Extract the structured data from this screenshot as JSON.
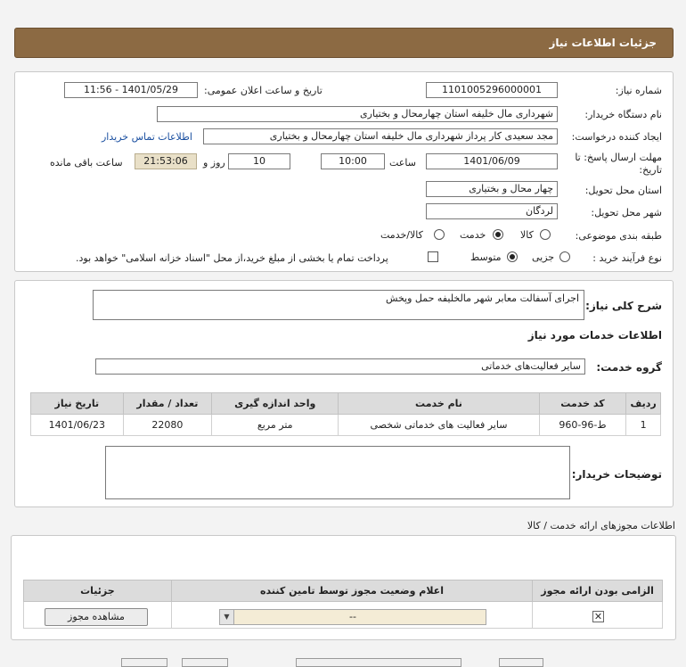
{
  "page_title": "جزئیات اطلاعات نیاز",
  "need_number": {
    "label": "شماره نیاز:",
    "value": "1101005296000001"
  },
  "announce_datetime": {
    "label": "تاریخ و ساعت اعلان عمومی:",
    "value": "1401/05/29 - 11:56"
  },
  "buyer_org": {
    "label": "نام دستگاه خریدار:",
    "value": "شهرداری مال خلیفه استان چهارمحال و بختیاری"
  },
  "requester": {
    "label": "ایجاد کننده درخواست:",
    "value": "مجد سعیدی کار پرداز شهرداری مال خلیفه استان چهارمحال و بختیاری",
    "contact_link": "اطلاعات تماس خریدار"
  },
  "deadline": {
    "label_line1": "مهلت ارسال پاسخ: تا",
    "label_line2": "تاریخ:",
    "date": "1401/06/09",
    "time_label": "ساعت",
    "time": "10:00",
    "days": "10",
    "days_label": "روز و",
    "remaining": "21:53:06",
    "remaining_label": "ساعت باقی مانده"
  },
  "delivery_province": {
    "label": "استان محل تحویل:",
    "value": "چهار محال و بختیاری"
  },
  "delivery_city": {
    "label": "شهر محل تحویل:",
    "value": "لردگان"
  },
  "category": {
    "label": "طبقه بندی موضوعی:",
    "options": [
      "کالا",
      "خدمت",
      "کالا/خدمت"
    ],
    "selected": "خدمت"
  },
  "purchase_process": {
    "label": "نوع فرآیند خرید :",
    "options": [
      "جزیی",
      "متوسط"
    ],
    "selected": "متوسط",
    "treasury_note": "پرداخت تمام یا بخشی از مبلغ خرید،از محل \"اسناد خزانه اسلامی\" خواهد بود."
  },
  "description": {
    "label": "شرح کلی نیاز:",
    "value": "اجرای آسفالت معابر شهر مالخلیفه حمل وپخش"
  },
  "services_heading": "اطلاعات خدمات مورد نیاز",
  "service_group": {
    "label": "گروه خدمت:",
    "value": "سایر فعالیت‌های خدماتی"
  },
  "items_table": {
    "headers": [
      "ردیف",
      "کد خدمت",
      "نام خدمت",
      "واحد اندازه گیری",
      "تعداد / مقدار",
      "تاریخ نیاز"
    ],
    "rows": [
      [
        "1",
        "ط-96-960",
        "سایر فعالیت های خدماتی شخصی",
        "متر مربع",
        "22080",
        "1401/06/23"
      ]
    ]
  },
  "buyer_notes": {
    "label": "توضیحات خریدار:"
  },
  "permits_heading": "اطلاعات مجوزهای ارائه خدمت / کالا",
  "permits_table": {
    "headers": [
      "الزامی بودن ارائه مجوز",
      "اعلام وضعیت مجوز توسط تامین کننده",
      "جزئیات"
    ],
    "status_value": "--",
    "view_button": "مشاهده مجوز"
  }
}
